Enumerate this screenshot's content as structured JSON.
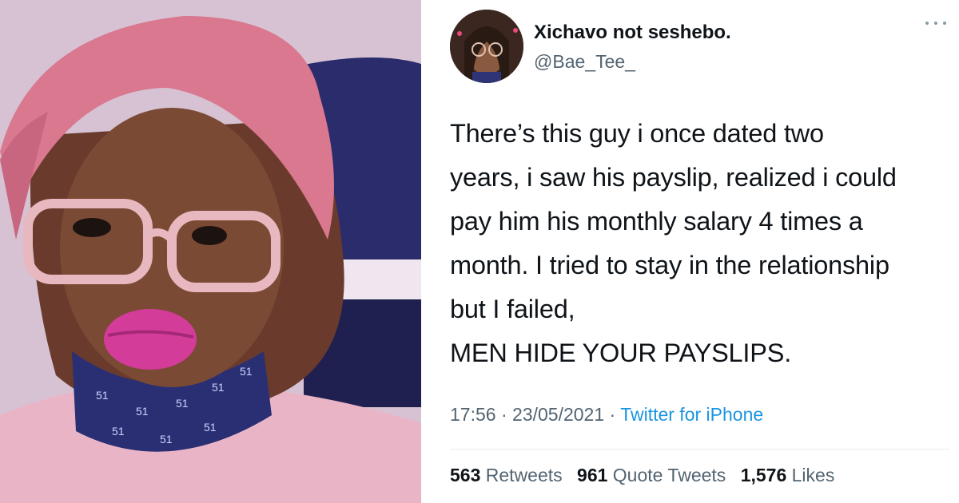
{
  "tweet": {
    "display_name": "Xichavo not seshebo.",
    "handle": "@Bae_Tee_",
    "more_icon": "more-horizontal-icon",
    "body": "There’s this guy i once dated two\nyears, i saw his payslip, realized i could\npay him his monthly salary 4 times a\nmonth. I tried to stay in the relationship\nbut I failed,\nMEN HIDE YOUR PAYSLIPS.",
    "time": "17:56",
    "date": "23/05/2021",
    "separator": "·",
    "source": "Twitter for iPhone",
    "stats": {
      "retweets_count": "563",
      "retweets_label": "Retweets",
      "quote_tweets_count": "961",
      "quote_tweets_label": "Quote Tweets",
      "likes_count": "1,576",
      "likes_label": "Likes"
    }
  },
  "colors": {
    "text_primary": "#0f1419",
    "text_secondary": "#536471",
    "link": "#1b95e0",
    "divider": "#e6ecf0"
  }
}
